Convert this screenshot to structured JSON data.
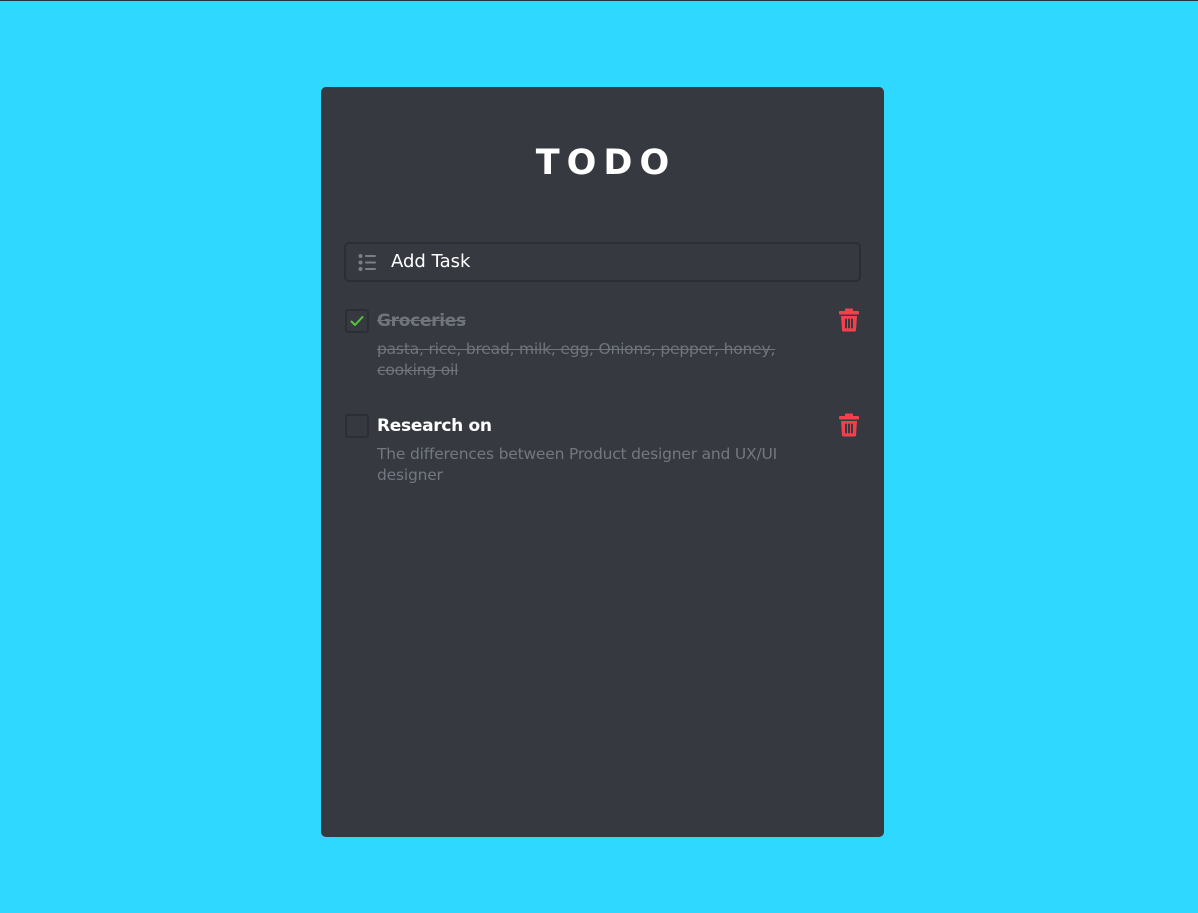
{
  "app": {
    "title": "TODO"
  },
  "add_task": {
    "placeholder": "Add Task",
    "icon": "list-icon"
  },
  "tasks": [
    {
      "title": "Groceries",
      "description": "pasta, rice, bread, milk, egg, Onions, pepper, honey, cooking oil",
      "completed": true
    },
    {
      "title": "Research on",
      "description": "The differences between Product designer and UX/UI designer",
      "completed": false
    }
  ],
  "colors": {
    "background": "#2ed8fe",
    "card": "#363940",
    "delete": "#f43f4c",
    "check": "#57c43a"
  }
}
